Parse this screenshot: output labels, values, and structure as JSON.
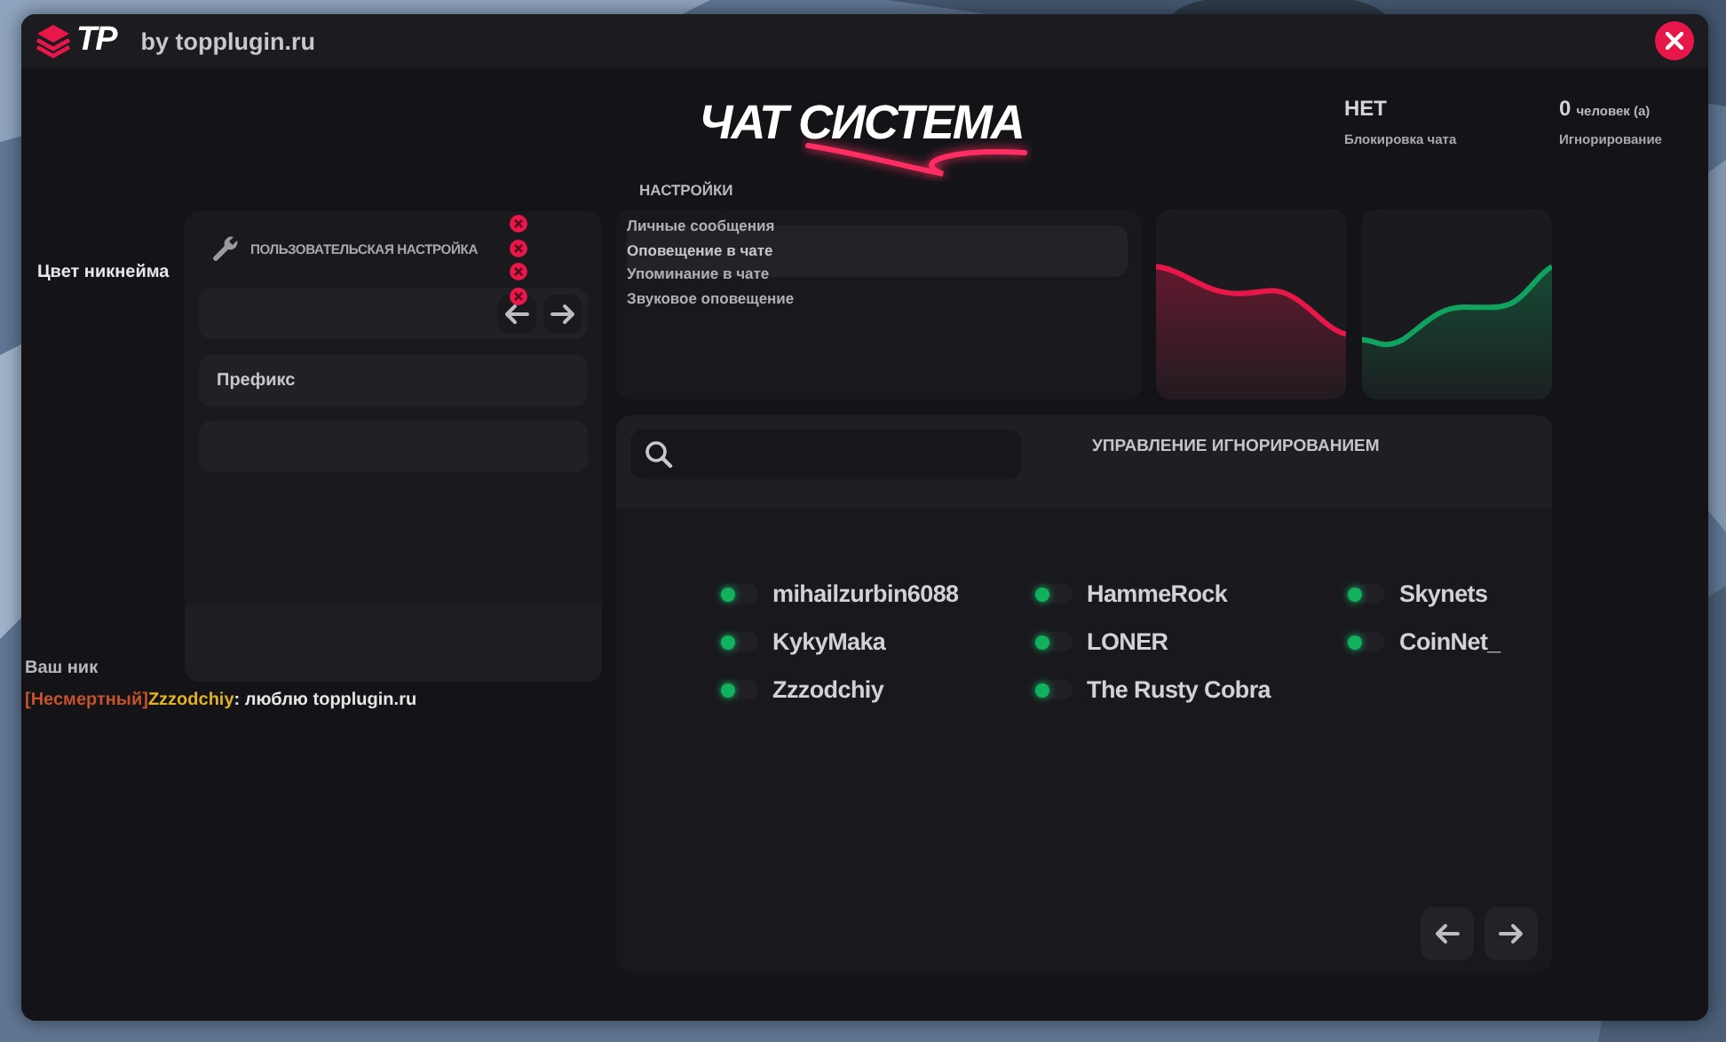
{
  "window": {
    "logo": "TP",
    "title": "by topplugin.ru"
  },
  "heading": "ЧАТ СИСТЕМА",
  "stats": [
    {
      "value": "НЕТ",
      "label": "Блокировка чата"
    },
    {
      "value": "0",
      "unit": "человек (а)",
      "label": "Игнорирование"
    }
  ],
  "nickname_color_label": "Цвет никнейма",
  "custom_settings": {
    "title": "ПОЛЬЗОВАТЕЛЬСКАЯ НАСТРОЙКА",
    "prefix_label": "Префикс"
  },
  "settings": {
    "title": "НАСТРОЙКИ",
    "items": [
      {
        "label": "Личные сообщения",
        "selected": false
      },
      {
        "label": "Оповещение в чате",
        "selected": true
      },
      {
        "label": "Упоминание в чате",
        "selected": false
      },
      {
        "label": "Звуковое оповещение",
        "selected": false
      }
    ]
  },
  "charts": [
    {
      "kind": "falling",
      "color": "#e8174a"
    },
    {
      "kind": "rising",
      "color": "#0fa35f"
    }
  ],
  "nick_preview": {
    "label": "Ваш ник",
    "parts": [
      {
        "text": "[Несмертный]",
        "color": "#c4532c"
      },
      {
        "text": "Zzzodchiy",
        "color": "#e0b323"
      },
      {
        "text": ": люблю topplugin.ru",
        "color": "#e6e6e6"
      }
    ]
  },
  "ignore": {
    "title": "УПРАВЛЕНИЕ ИГНОРИРОВАНИЕМ",
    "users": [
      {
        "name": "mihailzurbin6088",
        "on": false
      },
      {
        "name": "KykyMaka",
        "on": false
      },
      {
        "name": "Zzzodchiy",
        "on": false
      },
      {
        "name": "HammeRock",
        "on": false
      },
      {
        "name": "LONER",
        "on": false
      },
      {
        "name": "The Rusty Cobra",
        "on": false
      },
      {
        "name": "Skynets",
        "on": false
      },
      {
        "name": "CoinNet_",
        "on": false
      }
    ]
  }
}
